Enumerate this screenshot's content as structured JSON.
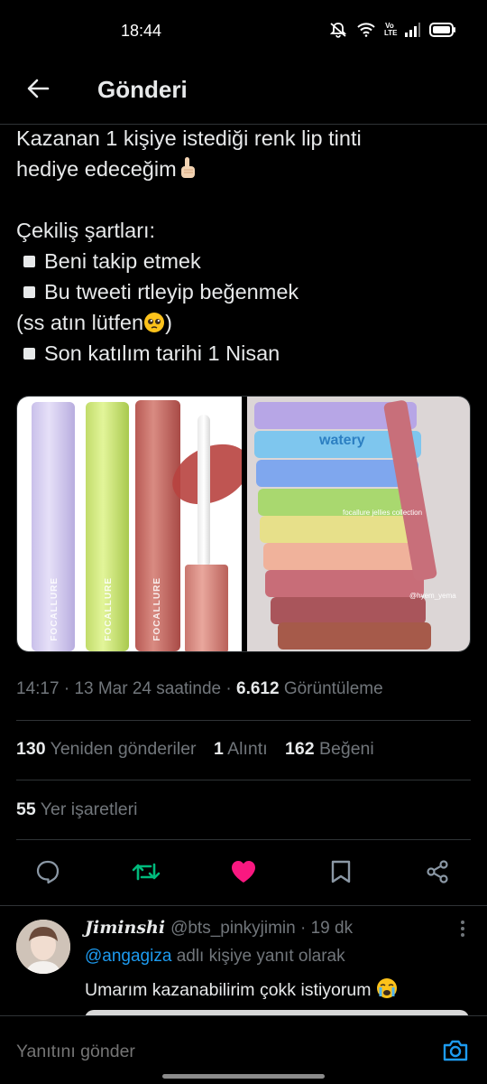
{
  "status_bar": {
    "time": "18:44",
    "icons": [
      "mute-icon",
      "wifi-icon",
      "volte-icon",
      "signal-icon",
      "battery-icon"
    ],
    "volte_top": "Vo",
    "volte_bottom": "LTE"
  },
  "header": {
    "back_icon": "arrow-left-icon",
    "title": "Gönderi"
  },
  "tweet": {
    "line1": "Kazanan 1 kişiye istediği renk lip tinti",
    "line2": "hediye edeceğim",
    "line3": "Çekiliş şartları:",
    "bullet1": "Beni takip etmek",
    "bullet2": "Bu tweeti rtleyip beğenmek",
    "line4": "(ss atın lütfen",
    "line4_end": ")",
    "bullet3": "Son katılım tarihi 1 Nisan",
    "media": {
      "left_brand": "FOCALLURE",
      "right_text_watery": "watery",
      "right_text_collection": "focallure jellies collection",
      "right_watermark": "@hyem_yema"
    }
  },
  "meta": {
    "time": "14:17",
    "sep": "·",
    "date": "13 Mar 24 saatinde",
    "views": "6.612",
    "views_label": "Görüntüleme"
  },
  "stats": {
    "retweets": "130",
    "retweets_label": "Yeniden gönderiler",
    "quotes": "1",
    "quotes_label": "Alıntı",
    "likes": "162",
    "likes_label": "Beğeni",
    "bookmarks": "55",
    "bookmarks_label": "Yer işaretleri"
  },
  "actions": {
    "reply_icon": "reply-icon",
    "retweet_icon": "retweet-icon",
    "like_icon": "heart-icon",
    "bookmark_icon": "bookmark-icon",
    "share_icon": "share-icon",
    "retweet_color": "#00ba7c",
    "like_color": "#f91880"
  },
  "reply": {
    "name": "Jiminshi",
    "handle": "@bts_pinkyjimin",
    "sep": "·",
    "age": "19 dk",
    "reply_to_mention": "@angagiza",
    "reply_to_suffix": "adlı kişiye yanıt olarak",
    "body": "Umarım kazanabilirim çokk istiyorum"
  },
  "composer": {
    "placeholder": "Yanıtını gönder",
    "camera_icon": "camera-icon",
    "accent": "#1d9bf0"
  }
}
